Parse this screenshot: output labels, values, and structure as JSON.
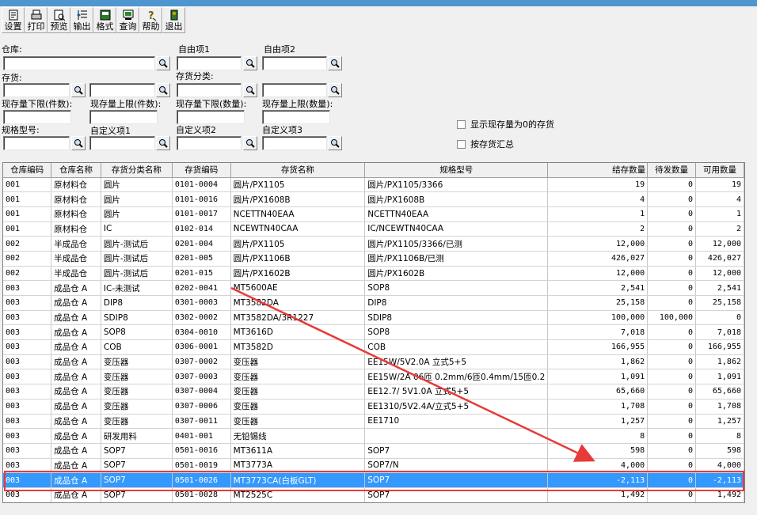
{
  "toolbar": {
    "buttons": [
      {
        "label": "设置",
        "icon": "settings-icon"
      },
      {
        "label": "打印",
        "icon": "print-icon"
      },
      {
        "label": "预览",
        "icon": "preview-icon"
      },
      {
        "label": "输出",
        "icon": "export-icon"
      },
      {
        "label": "格式",
        "icon": "format-icon"
      },
      {
        "label": "查询",
        "icon": "query-icon"
      },
      {
        "label": "帮助",
        "icon": "help-icon"
      },
      {
        "label": "退出",
        "icon": "exit-icon"
      }
    ]
  },
  "filters": {
    "warehouse_label": "仓库:",
    "custom1_label": "自由项1",
    "custom2_label": "自由项2",
    "inventory_label": "存货:",
    "inventory_class_label": "存货分类:",
    "min_qty_pieces_label": "现存量下限(件数):",
    "max_qty_pieces_label": "现存量上限(件数):",
    "min_qty_label": "现存量下限(数量):",
    "max_qty_label": "现存量上限(数量):",
    "spec_label": "规格型号:",
    "user_def1_label": "自定义项1",
    "user_def2_label": "自定义项2",
    "user_def3_label": "自定义项3",
    "show_zero_label": "显示现存量为0的存货",
    "summary_by_inventory_label": "按存货汇总"
  },
  "grid": {
    "columns": [
      "仓库编码",
      "仓库名称",
      "存货分类名称",
      "存货编码",
      "存货名称",
      "规格型号",
      "结存数量",
      "待发数量",
      "可用数量"
    ],
    "rows": [
      [
        "001",
        "原材料仓",
        "圆片",
        "0101-0004",
        "圆片/PX1105",
        "圆片/PX1105/3366",
        "19",
        "0",
        "19"
      ],
      [
        "001",
        "原材料仓",
        "圆片",
        "0101-0016",
        "圆片/PX1608B",
        "圆片/PX1608B",
        "4",
        "0",
        "4"
      ],
      [
        "001",
        "原材料仓",
        "圆片",
        "0101-0017",
        "NCETTN40EAA",
        "NCETTN40EAA",
        "1",
        "0",
        "1"
      ],
      [
        "001",
        "原材料仓",
        "IC",
        "0102-014",
        "NCEWTN40CAA",
        "IC/NCEWTN40CAA",
        "2",
        "0",
        "2"
      ],
      [
        "002",
        "半成品仓",
        "圆片-测试后",
        "0201-004",
        "圆片/PX1105",
        "圆片/PX1105/3366/已测",
        "12,000",
        "0",
        "12,000"
      ],
      [
        "002",
        "半成品仓",
        "圆片-测试后",
        "0201-005",
        "圆片/PX1106B",
        "圆片/PX1106B/已测",
        "426,027",
        "0",
        "426,027"
      ],
      [
        "002",
        "半成品仓",
        "圆片-测试后",
        "0201-015",
        "圆片/PX1602B",
        "圆片/PX1602B",
        "12,000",
        "0",
        "12,000"
      ],
      [
        "003",
        "成品仓 A",
        "IC-未测试",
        "0202-0041",
        "MT5600AE",
        "SOP8",
        "2,541",
        "0",
        "2,541"
      ],
      [
        "003",
        "成品仓 A",
        "DIP8",
        "0301-0003",
        "MT3582DA",
        "DIP8",
        "25,158",
        "0",
        "25,158"
      ],
      [
        "003",
        "成品仓 A",
        "SDIP8",
        "0302-0002",
        "MT3582DA/3R1227",
        "SDIP8",
        "100,000",
        "100,000",
        "0"
      ],
      [
        "003",
        "成品仓 A",
        "SOP8",
        "0304-0010",
        "MT3616D",
        "SOP8",
        "7,018",
        "0",
        "7,018"
      ],
      [
        "003",
        "成品仓 A",
        "COB",
        "0306-0001",
        "MT3582D",
        "COB",
        "166,955",
        "0",
        "166,955"
      ],
      [
        "003",
        "成品仓 A",
        "变压器",
        "0307-0002",
        "变压器",
        "EE15W/5V2.0A 立式5+5",
        "1,862",
        "0",
        "1,862"
      ],
      [
        "003",
        "成品仓 A",
        "变压器",
        "0307-0003",
        "变压器",
        "EE15W/2A 06匝 0.2mm/6匝0.4mm/15匝0.2",
        "1,091",
        "0",
        "1,091"
      ],
      [
        "003",
        "成品仓 A",
        "变压器",
        "0307-0004",
        "变压器",
        "EE12.7/ 5V1.0A 立式5+5",
        "65,660",
        "0",
        "65,660"
      ],
      [
        "003",
        "成品仓 A",
        "变压器",
        "0307-0006",
        "变压器",
        "EE1310/5V2.4A/立式5+5",
        "1,708",
        "0",
        "1,708"
      ],
      [
        "003",
        "成品仓 A",
        "变压器",
        "0307-0011",
        "变压器",
        "EE1710",
        "1,257",
        "0",
        "1,257"
      ],
      [
        "003",
        "成品仓 A",
        "研发用料",
        "0401-001",
        "无铅锡线",
        "",
        "8",
        "0",
        "8"
      ],
      [
        "003",
        "成品仓 A",
        "SOP7",
        "0501-0016",
        "MT3611A",
        "SOP7",
        "598",
        "0",
        "598"
      ],
      [
        "003",
        "成品仓 A",
        "SOP7",
        "0501-0019",
        "MT3773A",
        "SOP7/N",
        "4,000",
        "0",
        "4,000"
      ],
      [
        "003",
        "成品仓 A",
        "SOP7",
        "0501-0026",
        "MT3773CA(白板GLT)",
        "SOP7",
        "-2,113",
        "0",
        "-2,113"
      ],
      [
        "003",
        "成品仓 A",
        "SOP7",
        "0501-0028",
        "MT2525C",
        "SOP7",
        "1,492",
        "0",
        "1,492"
      ]
    ],
    "selected_row": 20
  },
  "colors": {
    "titlebar": "#4f96cf",
    "selection": "#3399ff",
    "annotation": "#e83a3a"
  }
}
